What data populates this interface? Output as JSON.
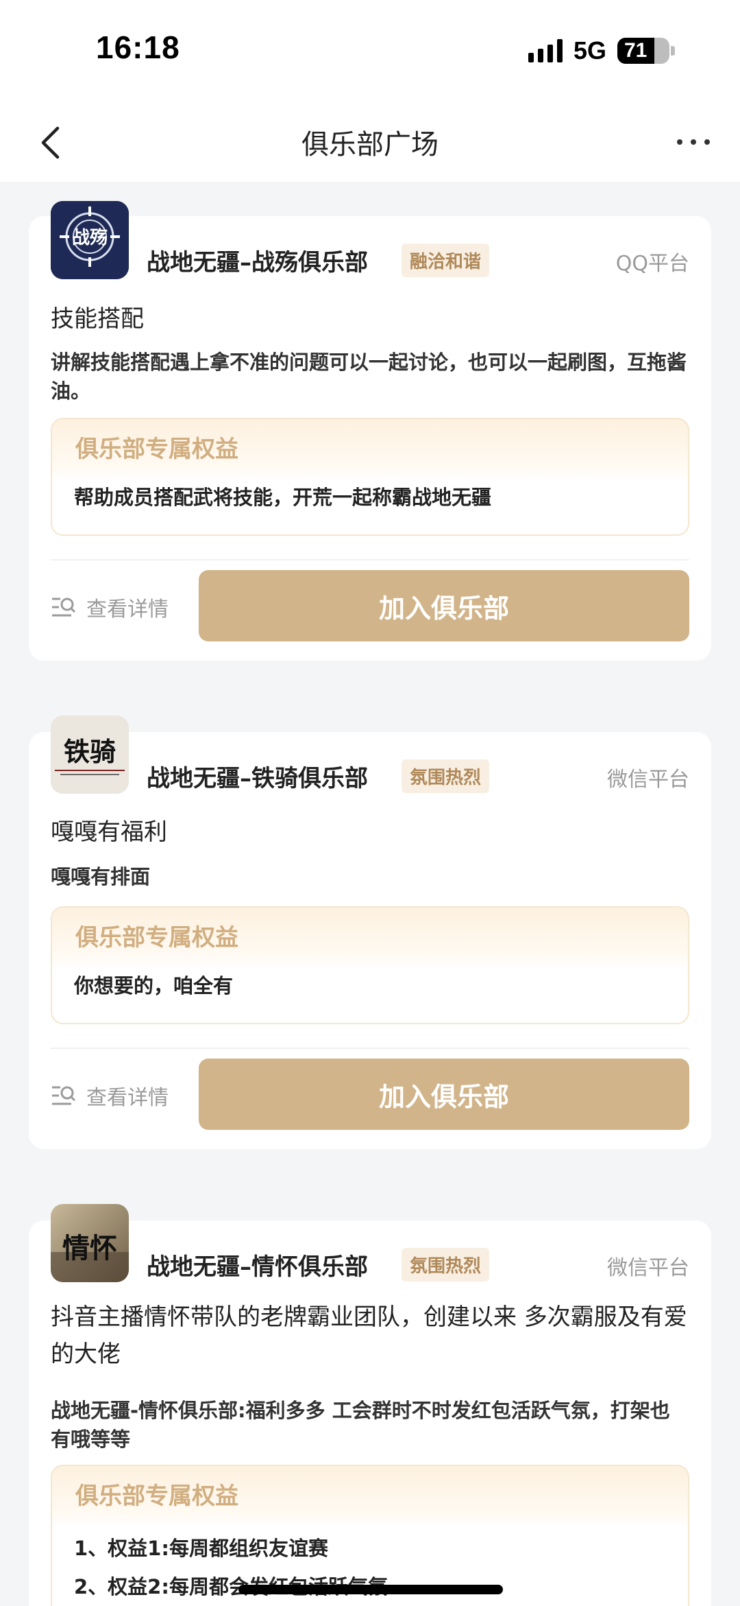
{
  "status_bar": {
    "time": "16:18",
    "network": "5G",
    "battery": "71"
  },
  "nav": {
    "title": "俱乐部广场"
  },
  "clubs": [
    {
      "logo_text": "战殇",
      "name": "战地无疆–战殇俱乐部",
      "tag": "融洽和谐",
      "platform": "QQ平台",
      "subtitle": "技能搭配",
      "description": "讲解技能搭配遇上拿不准的问题可以一起讨论，也可以一起刷图，互拖酱油。",
      "perk_title": "俱乐部专属权益",
      "perks": [
        "帮助成员搭配武将技能，开荒一起称霸战地无疆"
      ],
      "detail_label": "查看详情",
      "join_label": "加入俱乐部"
    },
    {
      "logo_text": "铁骑",
      "name": "战地无疆–铁骑俱乐部",
      "tag": "氛围热烈",
      "platform": "微信平台",
      "subtitle": "嘎嘎有福利",
      "description": "嘎嘎有排面",
      "perk_title": "俱乐部专属权益",
      "perks": [
        "你想要的，咱全有"
      ],
      "detail_label": "查看详情",
      "join_label": "加入俱乐部"
    },
    {
      "logo_text": "情怀",
      "name": "战地无疆–情怀俱乐部",
      "tag": "氛围热烈",
      "platform": "微信平台",
      "subtitle": "抖音主播情怀带队的老牌霸业团队，创建以来 多次霸服及有爱的大佬",
      "description": "战地无疆-情怀俱乐部:福利多多 工会群时不时发红包活跃气氛，打架也有哦等等",
      "perk_title": "俱乐部专属权益",
      "perks": [
        "1、权益1:每周都组织友谊赛",
        "2、权益2:每周都会发红包活跃气氛"
      ]
    }
  ],
  "colors": {
    "accent": "#d1b48a",
    "tag_text": "#b0895a",
    "tag_bg": "#f8efe2",
    "background": "#f4f5f7"
  }
}
